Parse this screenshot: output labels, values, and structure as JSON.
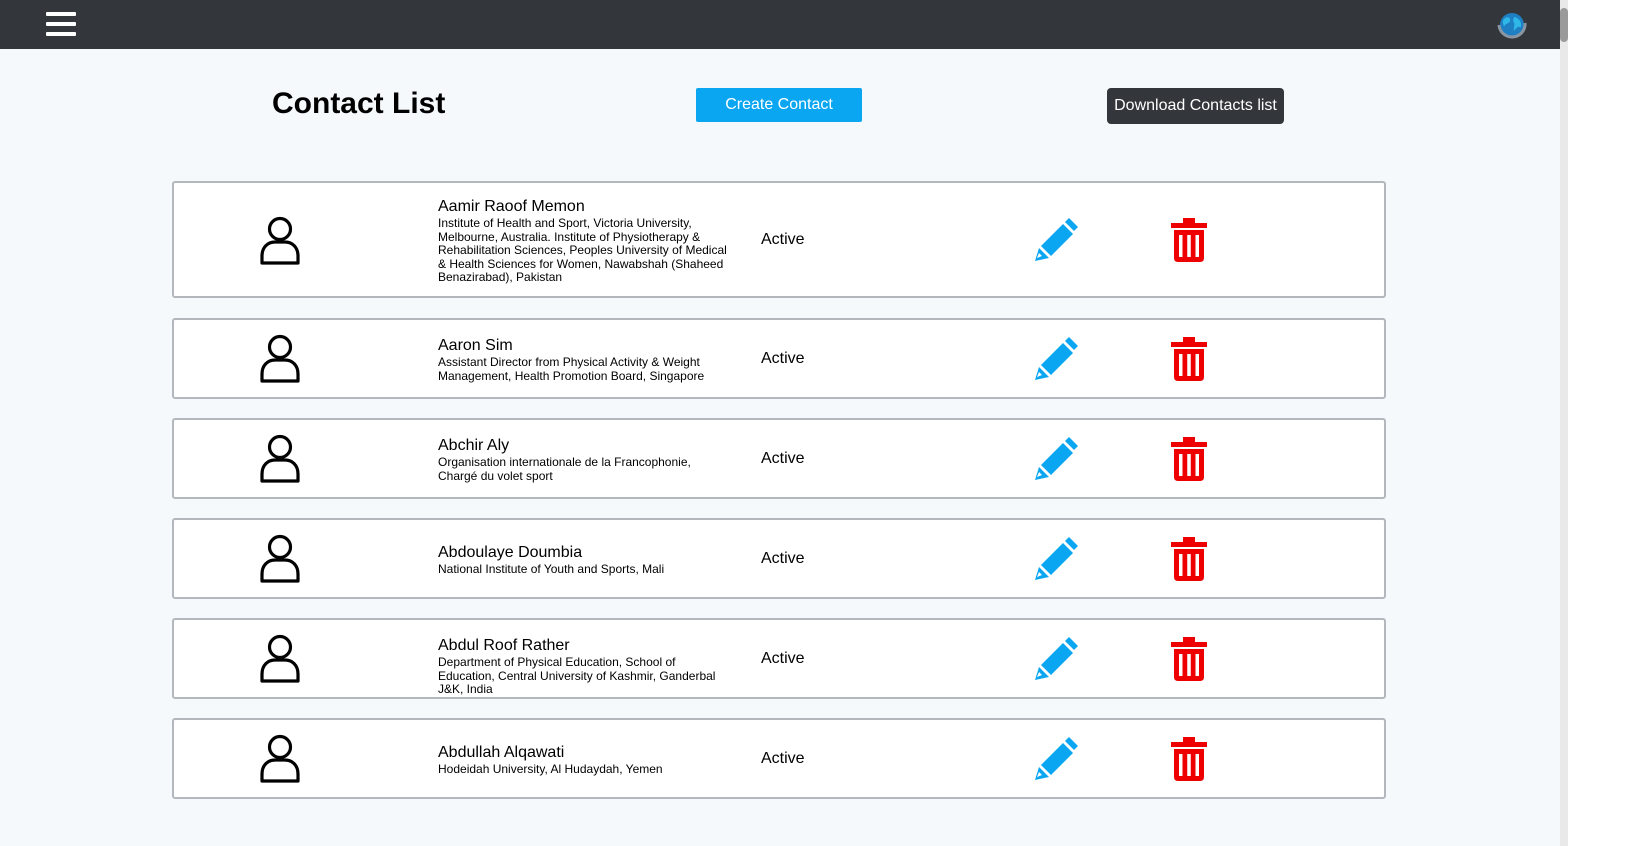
{
  "header": {
    "menu_icon": "hamburger-menu-icon",
    "globe_icon": "globe-icon"
  },
  "page": {
    "title": "Contact List",
    "create_label": "Create Contact",
    "download_label": "Download Contacts list"
  },
  "colors": {
    "topbar": "#33363b",
    "primary": "#0ba6f2",
    "delete": "#ee0000",
    "status": "#000000"
  },
  "icons": {
    "avatar": "user-avatar-icon",
    "edit": "pencil-icon",
    "delete": "trash-icon"
  },
  "contacts": [
    {
      "name": "Aamir Raoof Memon",
      "affiliation": "Institute of Health and Sport, Victoria University, Melbourne, Australia. Institute of Physiotherapy & Rehabilitation Sciences, Peoples University of Medical & Health Sciences for Women, Nawabshah (Shaheed Benazirabad), Pakistan",
      "status": "Active"
    },
    {
      "name": "Aaron Sim",
      "affiliation": "Assistant Director from Physical Activity & Weight Management, Health Promotion Board, Singapore",
      "status": "Active"
    },
    {
      "name": "Abchir Aly",
      "affiliation": "Organisation internationale de la Francophonie, Chargé du volet sport",
      "status": "Active"
    },
    {
      "name": "Abdoulaye Doumbia",
      "affiliation": "National Institute of Youth and Sports, Mali",
      "status": "Active"
    },
    {
      "name": "Abdul Roof Rather",
      "affiliation": "Department of Physical Education, School of Education, Central University of Kashmir, Ganderbal J&K, India",
      "status": "Active"
    },
    {
      "name": "Abdullah Alqawati",
      "affiliation": "Hodeidah University, Al Hudaydah, Yemen",
      "status": "Active"
    }
  ]
}
